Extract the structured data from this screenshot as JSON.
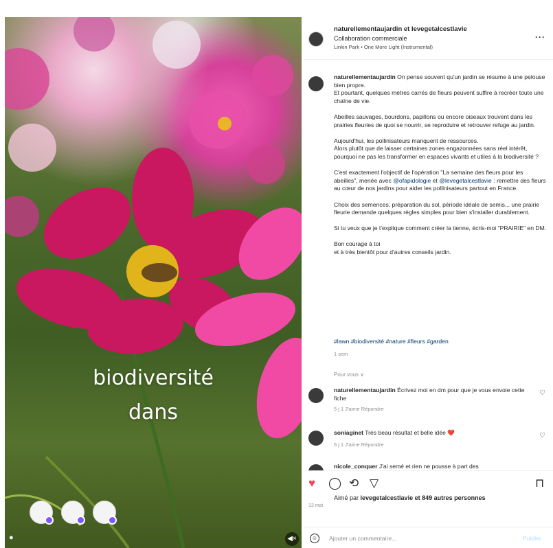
{
  "media": {
    "overlay_line1": "biodiversité",
    "overlay_line2": "dans"
  },
  "header": {
    "authors": "naturellementaujardin et levegetalcestlavie",
    "subtitle": "Collaboration commerciale",
    "music": "Linkin Park • One More Light (Instrumental)",
    "more_label": "···"
  },
  "caption": {
    "username": "naturellementaujardin",
    "p1": " On pense souvent qu'un jardin se résume à une pelouse bien propre.\nEt pourtant, quelques mètres carrés de fleurs peuvent suffire à recréer toute une chaîne de vie.",
    "p2": "Abeilles sauvages, bourdons, papillons ou encore oiseaux trouvent dans les prairies fleuries de quoi se nourrir, se reproduire et retrouver refuge au jardin.",
    "p3": "Aujourd'hui, les pollinisateurs manquent de ressources.\nAlors plutôt que de laisser certaines zones engazonnées sans réel intérêt, pourquoi ne pas les transformer en espaces vivants et utiles à la biodiversité ?",
    "p4a": "C'est exactement l'objectif de l'opération \"La semaine des fleurs pour les abeilles\", menée avec ",
    "mention1": "@ofapidologie",
    "p4b": " et ",
    "mention2": "@levegetalcestlavie",
    "p4c": " : remettre des fleurs au cœur de nos jardins pour aider les pollinisateurs partout en France.",
    "p5": "Choix des semences, préparation du sol, période idéale de semis... une prairie fleurie demande quelques règles simples pour bien s'installer durablement.",
    "p6": "Si tu veux que je t'explique comment créer la tienne, écris-moi \"PRAIRIE\" en DM.",
    "p7": "Bon courage à toi\net à très bientôt pour d'autres conseils jardin.",
    "hashtags": "#lawn #biodiversité #nature #fleurs #garden",
    "time": "1 sem"
  },
  "for_you": "Pour vous ∨",
  "comments": [
    {
      "user": "naturellementaujardin",
      "text": " Écrivez moi en dm pour que je vous envoie cette fiche",
      "meta": "5 j   1 J'aime   Répondre"
    },
    {
      "user": "soniaginet",
      "text": " Très beau résultat et belle idée ❤️",
      "meta": "6 j   1 J'aime   Répondre"
    },
    {
      "user": "nicole_conquer",
      "text": " J'ai semé et rien ne pousse à part des",
      "meta": ""
    }
  ],
  "actions": {
    "liked_by_prefix": "Aimé par ",
    "liked_by_user": "levegetalcestlavie",
    "liked_by_suffix": " et 849 autres personnes",
    "date": "13 mai"
  },
  "add_comment": {
    "placeholder": "Ajouter un commentaire...",
    "publish": "Publier"
  },
  "colors": {
    "like": "#ed4956",
    "link": "#00376b",
    "publish": "#b2dffc"
  }
}
